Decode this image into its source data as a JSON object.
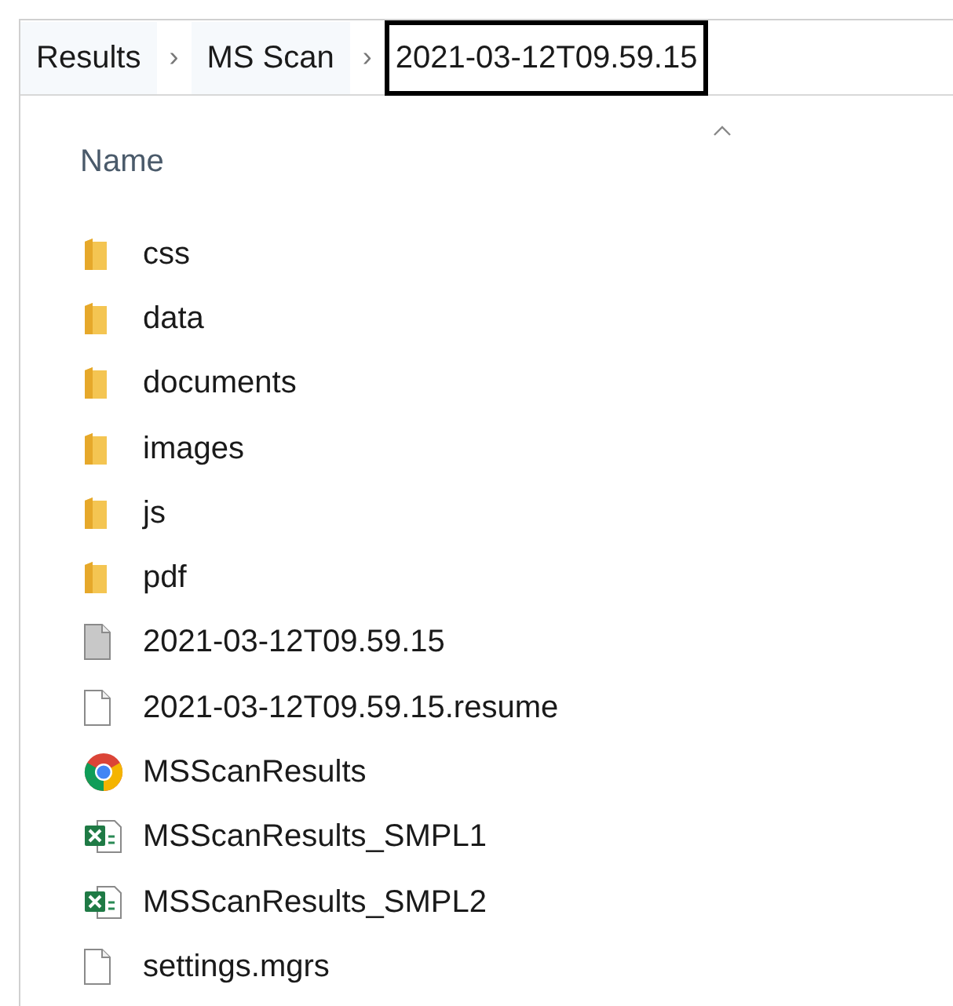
{
  "breadcrumb": [
    {
      "label": "Results",
      "highlighted": false
    },
    {
      "label": "MS Scan",
      "highlighted": false
    },
    {
      "label": "2021-03-12T09.59.15",
      "highlighted": true
    }
  ],
  "separator": "›",
  "column": {
    "label": "Name",
    "sort_ascending": true
  },
  "files": [
    {
      "name": "css",
      "kind": "folder"
    },
    {
      "name": "data",
      "kind": "folder"
    },
    {
      "name": "documents",
      "kind": "folder"
    },
    {
      "name": "images",
      "kind": "folder"
    },
    {
      "name": "js",
      "kind": "folder"
    },
    {
      "name": "pdf",
      "kind": "folder"
    },
    {
      "name": "2021-03-12T09.59.15",
      "kind": "data"
    },
    {
      "name": "2021-03-12T09.59.15.resume",
      "kind": "file"
    },
    {
      "name": "MSScanResults",
      "kind": "browser"
    },
    {
      "name": "MSScanResults_SMPL1",
      "kind": "spreadsheet"
    },
    {
      "name": "MSScanResults_SMPL2",
      "kind": "spreadsheet"
    },
    {
      "name": "settings.mgrs",
      "kind": "file"
    }
  ]
}
